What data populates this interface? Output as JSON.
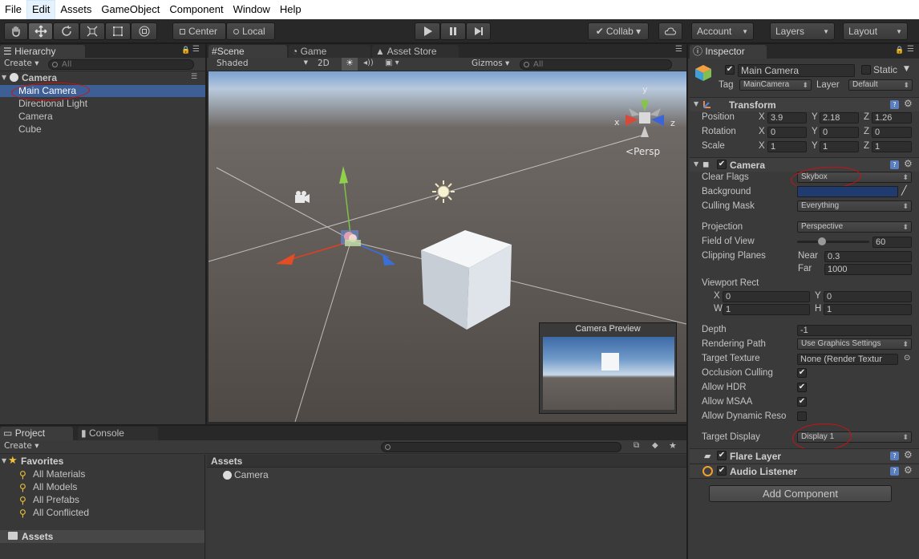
{
  "menu": [
    "File",
    "Edit",
    "Assets",
    "GameObject",
    "Component",
    "Window",
    "Help"
  ],
  "toolbar": {
    "pivot": "Center",
    "space": "Local",
    "collab": "Collab ▾",
    "account": "Account",
    "layers": "Layers",
    "layout": "Layout"
  },
  "hierarchy": {
    "tab": "Hierarchy",
    "create": "Create ▾",
    "search_placeholder": "All",
    "scene_name": "Camera",
    "items": [
      "Main Camera",
      "Directional Light",
      "Camera",
      "Cube"
    ]
  },
  "scene": {
    "tabs": [
      "Scene",
      "Game",
      "Asset Store"
    ],
    "shading": "Shaded",
    "mode_2d": "2D",
    "gizmos": "Gizmos ▾",
    "search_placeholder": "All",
    "persp_label": "Persp",
    "axis_labels": {
      "x": "x",
      "y": "y",
      "z": "z"
    },
    "preview_title": "Camera Preview"
  },
  "project": {
    "tabs": [
      "Project",
      "Console"
    ],
    "create": "Create ▾",
    "favorites_label": "Favorites",
    "favorites": [
      "All Materials",
      "All Models",
      "All Prefabs",
      "All Conflicted"
    ],
    "assets_label": "Assets",
    "assets_header": "Assets",
    "asset_items": [
      "Camera"
    ]
  },
  "inspector": {
    "tab": "Inspector",
    "object_name": "Main Camera",
    "static_label": "Static",
    "tag_label": "Tag",
    "tag_value": "MainCamera",
    "layer_label": "Layer",
    "layer_value": "Default",
    "transform": {
      "title": "Transform",
      "position_label": "Position",
      "rotation_label": "Rotation",
      "scale_label": "Scale",
      "axis": [
        "X",
        "Y",
        "Z"
      ],
      "position": [
        "3.9",
        "2.18",
        "1.26"
      ],
      "rotation": [
        "0",
        "0",
        "0"
      ],
      "scale": [
        "1",
        "1",
        "1"
      ]
    },
    "camera": {
      "title": "Camera",
      "clear_flags_label": "Clear Flags",
      "clear_flags": "Skybox",
      "background_label": "Background",
      "background_color": "#1f3b70",
      "culling_mask_label": "Culling Mask",
      "culling_mask": "Everything",
      "projection_label": "Projection",
      "projection": "Perspective",
      "fov_label": "Field of View",
      "fov": "60",
      "fov_fraction": 0.33,
      "clipping_label": "Clipping Planes",
      "near_label": "Near",
      "near": "0.3",
      "far_label": "Far",
      "far": "1000",
      "viewport_label": "Viewport Rect",
      "vp_x_label": "X",
      "vp_x": "0",
      "vp_y_label": "Y",
      "vp_y": "0",
      "vp_w_label": "W",
      "vp_w": "1",
      "vp_h_label": "H",
      "vp_h": "1",
      "depth_label": "Depth",
      "depth": "-1",
      "rendering_path_label": "Rendering Path",
      "rendering_path": "Use Graphics Settings",
      "target_texture_label": "Target Texture",
      "target_texture": "None (Render Textur",
      "occlusion_label": "Occlusion Culling",
      "hdr_label": "Allow HDR",
      "msaa_label": "Allow MSAA",
      "dynamic_label": "Allow Dynamic Reso",
      "target_display_label": "Target Display",
      "target_display": "Display 1"
    },
    "flare_layer": "Flare Layer",
    "audio_listener": "Audio Listener",
    "add_component": "Add Component"
  }
}
